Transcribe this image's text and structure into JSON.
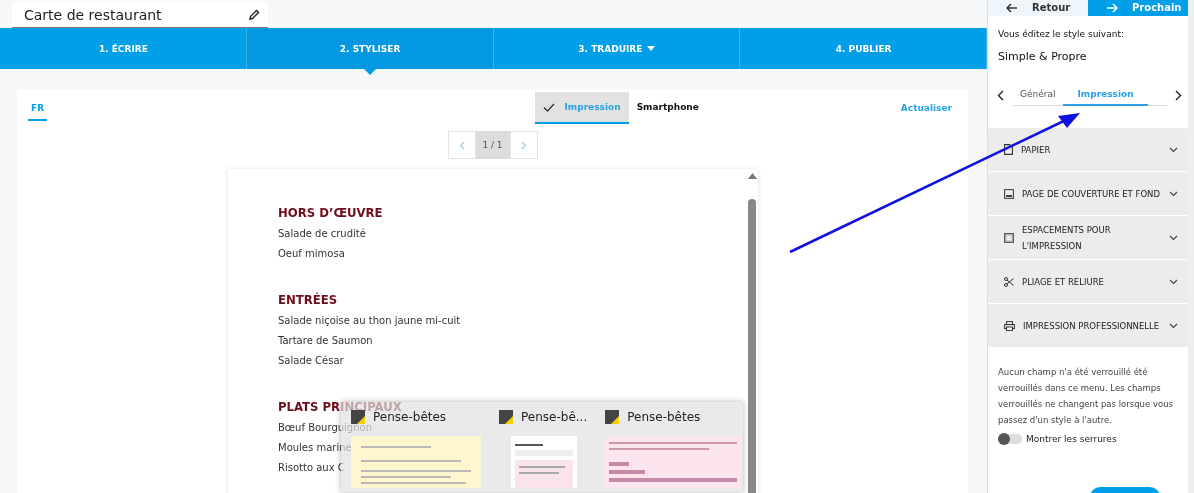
{
  "document_title": "Carte de restaurant",
  "steps": [
    {
      "label": "1. ÉCRIRE",
      "selected": false,
      "dropdown": false
    },
    {
      "label": "2. STYLISER",
      "selected": true,
      "dropdown": false
    },
    {
      "label": "3. TRADUIRE",
      "selected": false,
      "dropdown": true
    },
    {
      "label": "4. PUBLIER",
      "selected": false,
      "dropdown": false
    }
  ],
  "languages": [
    {
      "label": "FR",
      "selected": true
    }
  ],
  "views": [
    {
      "label": "Impression",
      "selected": true
    },
    {
      "label": "Smartphone",
      "selected": false
    }
  ],
  "refresh": "Actualiser",
  "pagination": {
    "page": "1 / 1"
  },
  "menu_sections": [
    {
      "title": "HORS D’ŒUVRE",
      "items": [
        "Salade de crudité",
        "Oeuf mimosa"
      ]
    },
    {
      "title": "ENTRÉES",
      "items": [
        "Salade niçoise au thon jaune mi-cuit",
        "Tartare de Saumon",
        "Salade César"
      ]
    },
    {
      "title": "PLATS PRINCIPAUX",
      "items": [
        "Bœuf Bourguignon",
        "Moules marine",
        "Risotto aux C"
      ]
    }
  ],
  "taskbar_previews": [
    {
      "title": "Pense-bêtes",
      "kind": "note"
    },
    {
      "title": "Pense-bê...",
      "kind": "app"
    },
    {
      "title": "Pense-bêtes",
      "kind": "pink"
    }
  ],
  "sidebar": {
    "back": "Retour",
    "next": "Prochain",
    "editing_label": "Vous éditez le style suivant:",
    "style_name": "Simple & Propre",
    "tabs": [
      {
        "label": "Général",
        "selected": false
      },
      {
        "label": "Impression",
        "selected": true
      }
    ],
    "sections": [
      {
        "label": "PAPIER",
        "kind": "page",
        "expanded": false
      },
      {
        "label": "PAGE DE COUVERTURE ET FOND",
        "kind": "image",
        "expanded": false
      },
      {
        "label": "ESPACEMENTS POUR L'IMPRESSION",
        "kind": "layout",
        "expanded": false
      },
      {
        "label": "PLIAGE ET RELIURE",
        "kind": "scissors",
        "expanded": false
      },
      {
        "label": "IMPRESSION PROFESSIONNELLE",
        "kind": "printer",
        "expanded": false
      }
    ],
    "notice": "Aucun champ n'a été verrouillé été verrouillés dans ce menu. Les champs verrouillés ne changent pas lorsque vous passez d'un style à l'autre.",
    "show_locks": {
      "label": "Montrer les serrures",
      "on": false
    }
  }
}
